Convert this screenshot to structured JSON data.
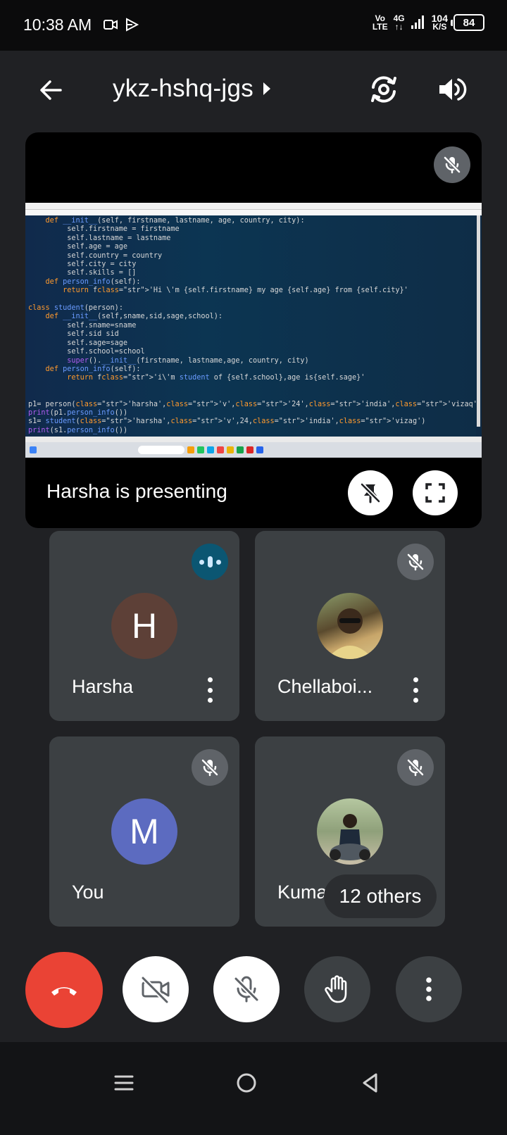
{
  "status_bar": {
    "time": "10:38 AM",
    "volte_top": "Vo",
    "volte_bottom": "LTE",
    "network_top": "4G",
    "network_bottom": "↑↓",
    "speed_value": "104",
    "speed_unit": "K/S",
    "battery": "84"
  },
  "header": {
    "meeting_code": "ykz-hshq-jgs",
    "icons": [
      "back-arrow-icon",
      "switch-camera-icon",
      "speaker-icon"
    ]
  },
  "presentation": {
    "label": "Harsha is presenting",
    "code_lines": [
      "    def __init__(self, firstname, lastname, age, country, city):",
      "         self.firstname = firstname",
      "         self.lastname = lastname",
      "         self.age = age",
      "         self.country = country",
      "         self.city = city",
      "         self.skills = []",
      "    def person_info(self):",
      "        return f'Hi \\'m {self.firstname} my age {self.age} from {self.city}'",
      "",
      "class student(person):",
      "    def __init__(self,sname,sid,sage,school):",
      "         self.sname=sname",
      "         self.sid sid",
      "         self.sage=sage",
      "         self.school=school",
      "         super().__init__(firstname, lastname,age, country, city)",
      "    def person_info(self):",
      "         return f'i\\'m student of {self.school},age is{self.sage}'",
      "",
      "",
      "p1= person('harsha','v','24','india','vizaq')",
      "print(p1.person_info())",
      "s1= student('harsha','v',24,'india','vizag')",
      "print(s1.person_info())"
    ]
  },
  "participants": [
    {
      "name": "Harsha",
      "initial": "H",
      "avatar_color": "#5d4037",
      "state": "speaking"
    },
    {
      "name": "Chellaboi...",
      "initial": "",
      "avatar_color": "#6b5a3a",
      "state": "muted"
    },
    {
      "name": "You",
      "initial": "M",
      "avatar_color": "#5c6bc0",
      "state": "muted"
    },
    {
      "name": "Kumar",
      "initial": "",
      "avatar_color": "#7a8a6a",
      "state": "muted"
    }
  ],
  "others_chip": "12 others",
  "colors": {
    "background": "#202124",
    "tile": "#3c4043",
    "end_call": "#ea4335",
    "speaking": "#0b5672"
  }
}
